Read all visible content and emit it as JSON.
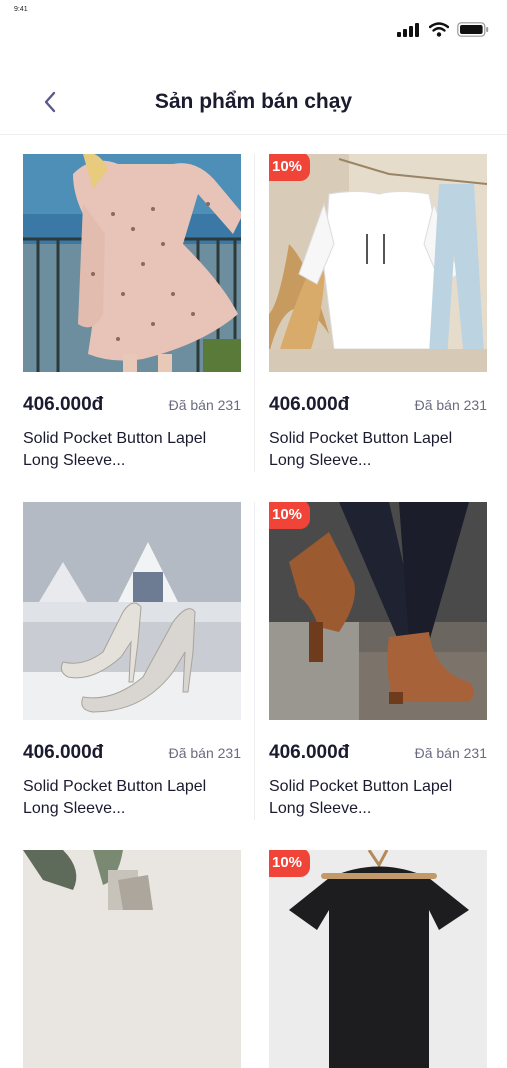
{
  "status": {
    "time": "9:41",
    "icons": [
      "signal-icon",
      "wifi-icon",
      "battery-icon"
    ]
  },
  "header": {
    "title": "Sản phẩm bán chạy",
    "back_icon": "chevron-left-icon"
  },
  "products": [
    {
      "image": "pink-floral-dress",
      "badge": "",
      "price": "406.000đ",
      "sold": "Đã bán 231",
      "name_line1": "Solid Pocket Button Lapel",
      "name_line2": "Long Sleeve..."
    },
    {
      "image": "white-hoodie-jeans",
      "badge": "10%",
      "price": "406.000đ",
      "sold": "Đã bán 231",
      "name_line1": "Solid Pocket Button Lapel",
      "name_line2": "Long Sleeve..."
    },
    {
      "image": "silver-high-heels",
      "badge": "",
      "price": "406.000đ",
      "sold": "Đã bán 231",
      "name_line1": "Solid Pocket Button Lapel",
      "name_line2": "Long Sleeve..."
    },
    {
      "image": "brown-ankle-boots",
      "badge": "10%",
      "price": "406.000đ",
      "sold": "Đã bán 231",
      "name_line1": "Solid Pocket Button Lapel",
      "name_line2": "Long Sleeve..."
    },
    {
      "image": "plant-and-shoes",
      "badge": ""
    },
    {
      "image": "black-tshirt-hanger",
      "badge": "10%"
    }
  ],
  "colors": {
    "badge": "#f04438",
    "title": "#1b1b2f",
    "muted": "#6b6b80",
    "back": "#5a5a8c"
  }
}
